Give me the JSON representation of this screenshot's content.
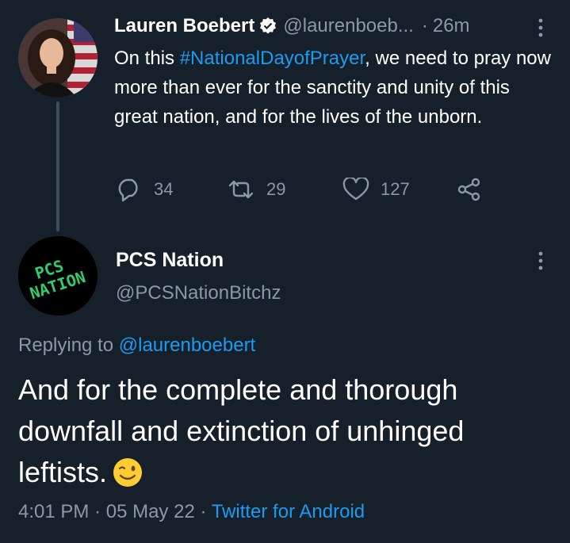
{
  "parent_tweet": {
    "author_name": "Lauren Boebert",
    "author_handle": "@laurenboeb...",
    "separator": "·",
    "time_ago": "26m",
    "text_before": "On this ",
    "hashtag": "#NationalDayofPrayer",
    "text_after": ", we need to pray now more than ever for the sanctity and unity of this great nation, and for the lives of the unborn.",
    "replies": "34",
    "retweets": "29",
    "likes": "127"
  },
  "main_tweet": {
    "author_name": "PCS Nation",
    "author_handle": "@PCSNationBitchz",
    "avatar_text_line1": "PCS",
    "avatar_text_line2": "NATION",
    "replying_label": "Replying to ",
    "replying_handle": "@laurenboebert",
    "text": "And for the complete and thorough downfall and extinction of unhinged leftists.",
    "time": "4:01 PM",
    "meta_sep1": " · ",
    "date": "05 May 22",
    "meta_sep2": " · ",
    "source": "Twitter for Android"
  },
  "colors": {
    "background": "#15202b",
    "link": "#1d9bf0",
    "secondary_text": "#8b98a5",
    "avatar_text": "#2ecc71"
  },
  "icons": [
    "verified-badge-icon",
    "more-options-icon",
    "reply-icon",
    "retweet-icon",
    "like-icon",
    "share-icon",
    "winking-face-emoji"
  ]
}
